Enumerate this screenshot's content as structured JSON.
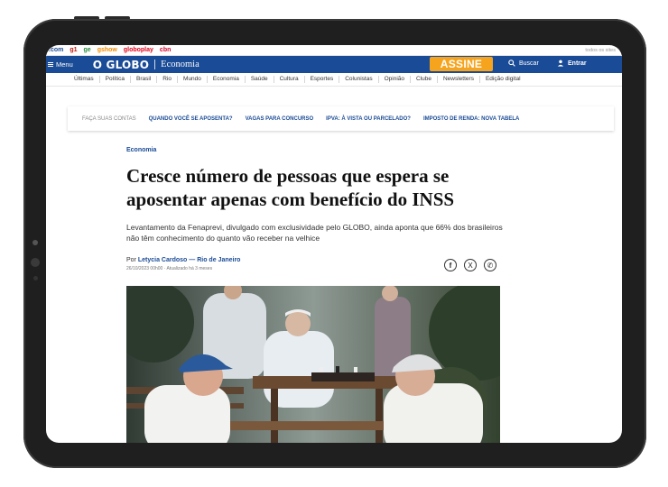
{
  "globo_bar": {
    "sites": [
      {
        "label": ".com",
        "color": "#1a4b96"
      },
      {
        "label": "g1",
        "color": "#c4170c"
      },
      {
        "label": "ge",
        "color": "#2b8a3e"
      },
      {
        "label": "gshow",
        "color": "#f28c00"
      },
      {
        "label": "globoplay",
        "color": "#e2001a"
      },
      {
        "label": "cbn",
        "color": "#d6002a"
      }
    ],
    "all_sites": "todos os sites"
  },
  "header": {
    "menu_label": "Menu",
    "brand": "O GLOBO",
    "section": "Economia",
    "subscribe_label": "ASSINE",
    "search_label": "Buscar",
    "login_label": "Entrar",
    "color": "#1a4b96",
    "subscribe_color": "#f6a41e"
  },
  "nav": {
    "items": [
      "Últimas",
      "Política",
      "Brasil",
      "Rio",
      "Mundo",
      "Economia",
      "Saúde",
      "Cultura",
      "Esportes",
      "Colunistas",
      "Opinião",
      "Clube",
      "Newsletters",
      "Edição digital"
    ]
  },
  "trending": {
    "label": "FAÇA SUAS CONTAS",
    "links": [
      "QUANDO VOCÊ SE APOSENTA?",
      "VAGAS PARA CONCURSO",
      "IPVA: À VISTA OU PARCELADO?",
      "IMPOSTO DE RENDA: NOVA TABELA"
    ]
  },
  "article": {
    "category": "Economia",
    "title": "Cresce número de pessoas que espera se aposentar apenas com benefício do INSS",
    "subtitle": "Levantamento da Fenaprevi, divulgado com exclusividade pelo GLOBO, ainda aponta que 66% dos brasileiros não têm conhecimento do quanto vão receber na velhice",
    "byline_prefix": "Por",
    "author": "Letycia Cardoso — Rio de Janeiro",
    "date": "26/10/2023 00h00 · Atualizado há 3 meses",
    "share": {
      "facebook": "f",
      "x": "X",
      "whatsapp": "✆"
    }
  }
}
